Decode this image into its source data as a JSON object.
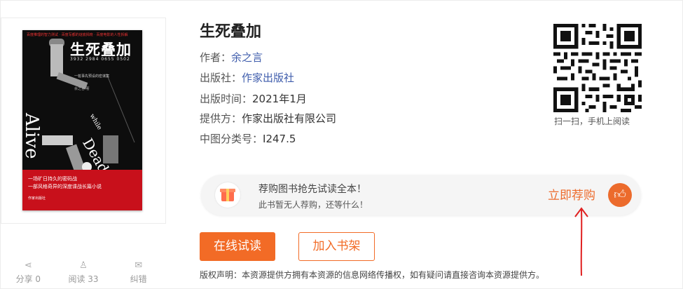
{
  "book": {
    "title": "生死叠加",
    "author_label": "作者：",
    "author": "余之言",
    "publisher_label": "出版社：",
    "publisher": "作家出版社",
    "pubdate_label": "出版时间：",
    "pubdate": "2021年1月",
    "provider_label": "提供方：",
    "provider": "作家出版社有限公司",
    "clc_label": "中图分类号：",
    "clc": "I247.5"
  },
  "cover": {
    "top_text": "百度推理的智力测试 · 百度写都的谜底揭晓 · 百度电影的人性拆解",
    "title": "生死叠加",
    "numbers": "3932 2984 0655 0502",
    "subtitle": "一桩事先预设的密谋案",
    "author": "余之言 著",
    "word_alive": "Alive",
    "word_while": "while",
    "word_dead": "Dead",
    "tagline_1": "一场旷日持久的密码战",
    "tagline_2": "一部风格奇异的深度谍战长篇小说",
    "publisher": "作家出版社"
  },
  "qr": {
    "caption": "扫一扫，手机上阅读"
  },
  "banner": {
    "line1": "荐购图书抢先试读全本！",
    "line2": "此书暂无人荐购，还等什么！",
    "button": "立即荐购",
    "icon": "thumbs-up-icon"
  },
  "actions": {
    "read_online": "在线试读",
    "add_shelf": "加入书架"
  },
  "notice": "版权声明：本资源提供方拥有本资源的信息网络传播权，如有疑问请直接咨询本资源提供方。",
  "stats": [
    {
      "icon": "share-icon",
      "label": "分享 0"
    },
    {
      "icon": "user-icon",
      "label": "阅读 33"
    },
    {
      "icon": "mail-icon",
      "label": "纠错"
    }
  ],
  "colors": {
    "accent": "#f26b26",
    "link": "#3f5dac",
    "annotation_arrow": "#e02020"
  }
}
